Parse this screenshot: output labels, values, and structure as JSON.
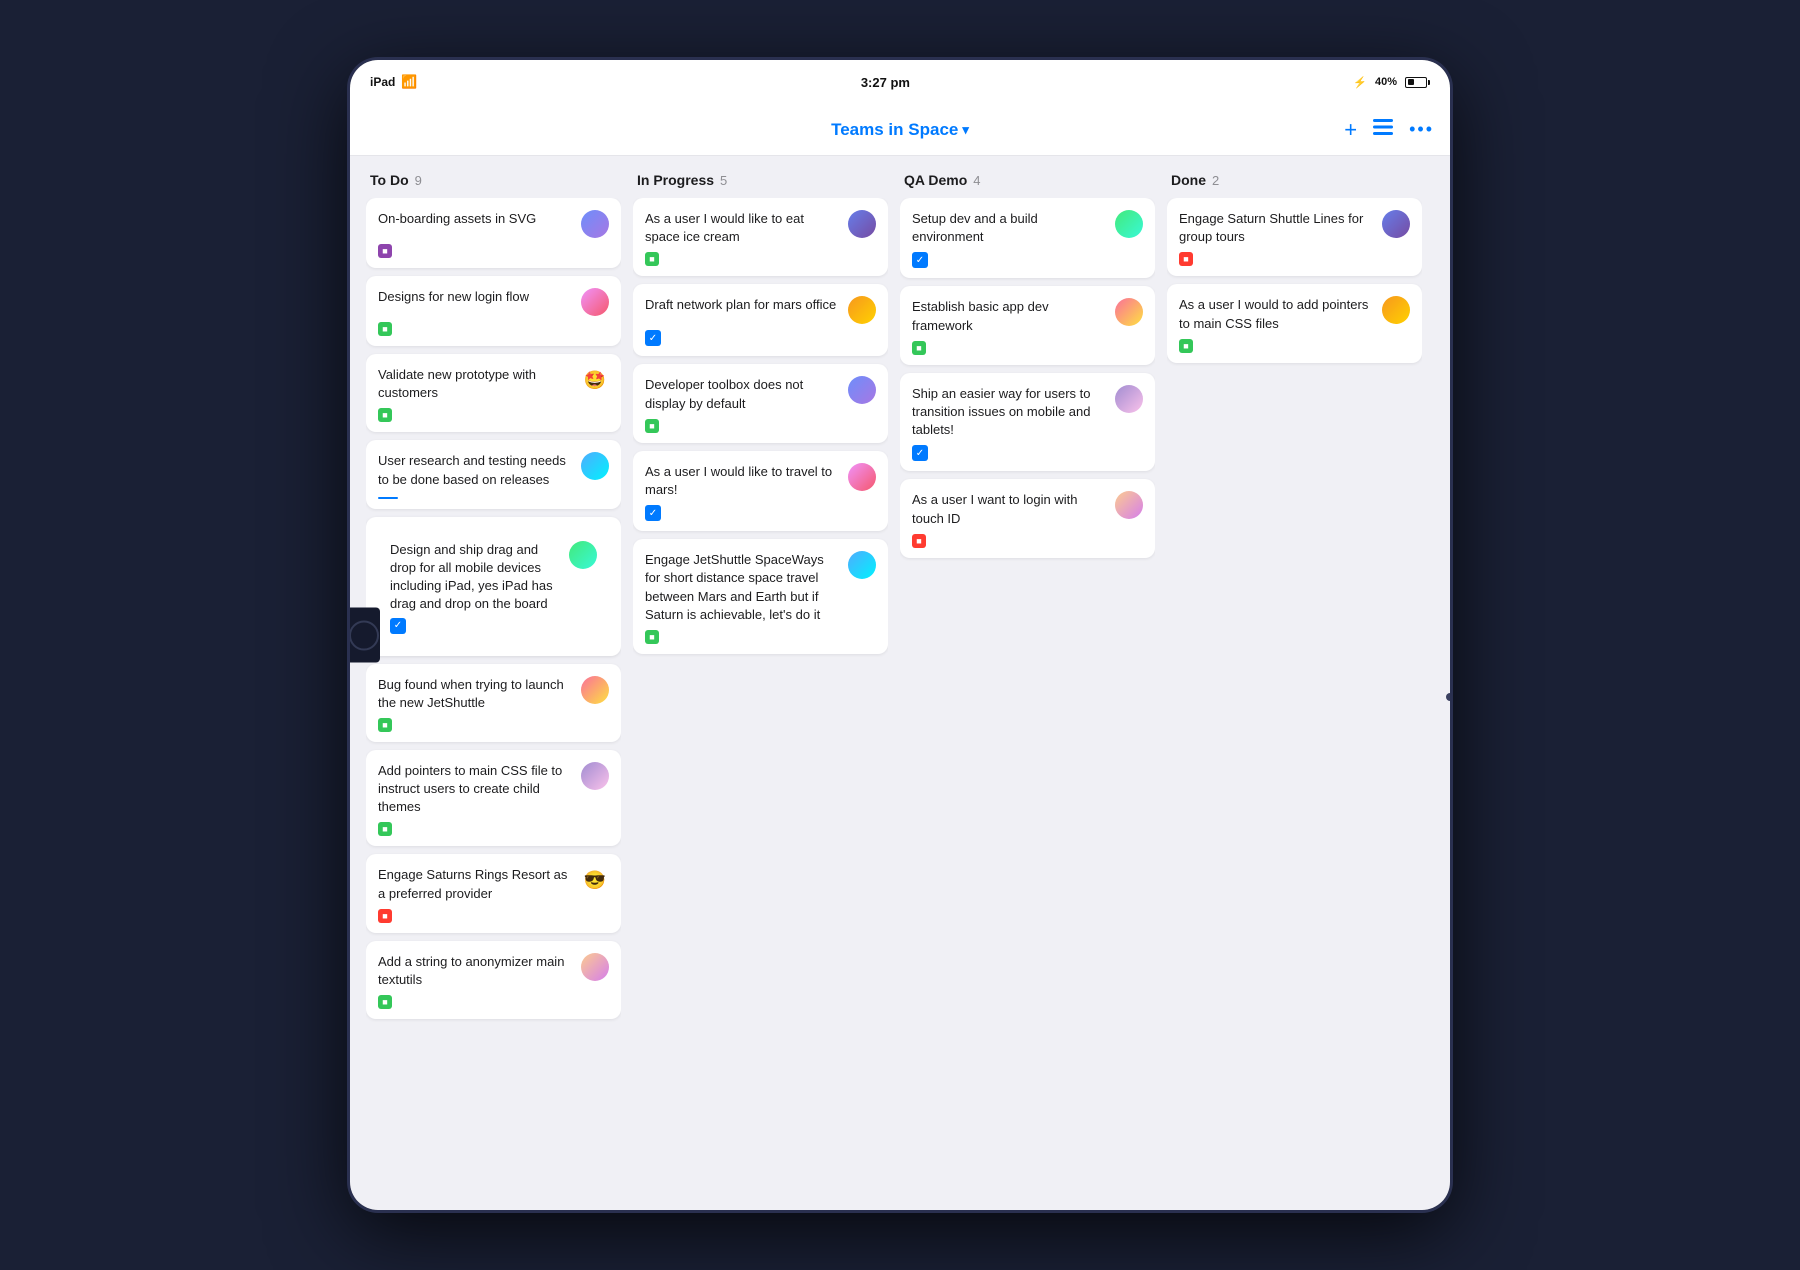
{
  "device": {
    "status_left": "iPad",
    "time": "3:27 pm",
    "battery": "40%",
    "wifi": "▾"
  },
  "header": {
    "title": "Teams in Space",
    "chevron": "▾",
    "plus_label": "+",
    "list_label": "≡",
    "more_label": "•••"
  },
  "columns": [
    {
      "id": "todo",
      "title": "To Do",
      "count": "9",
      "cards": [
        {
          "id": "c1",
          "text": "On-boarding assets in SVG",
          "avatar": "1",
          "tag": "purple"
        },
        {
          "id": "c2",
          "text": "Designs for new login flow",
          "avatar": "2",
          "tag": "green"
        },
        {
          "id": "c3",
          "text": "Validate new prototype with customers",
          "avatar": "emoji_smiley",
          "tag": "green"
        },
        {
          "id": "c4",
          "text": "User research and testing needs to be done based on releases",
          "avatar": "3",
          "tag": "blue-line"
        },
        {
          "id": "c5",
          "text": "Design and ship drag and drop for all mobile devices including iPad, yes iPad has drag and drop on the board",
          "avatar": "4",
          "tag": "blue-check",
          "expanded": true
        },
        {
          "id": "c6",
          "text": "Bug found when trying to launch the new JetShuttle",
          "avatar": "5",
          "tag": "green"
        },
        {
          "id": "c7",
          "text": "Add pointers to main CSS file to instruct users to create child themes",
          "avatar": "6",
          "tag": "green"
        },
        {
          "id": "c8",
          "text": "Engage Saturns Rings Resort as a preferred provider",
          "avatar": "emoji_smiley2",
          "tag": "red"
        },
        {
          "id": "c9",
          "text": "Add a string to anonymizer main textutils",
          "avatar": "7",
          "tag": "green"
        }
      ]
    },
    {
      "id": "inprogress",
      "title": "In Progress",
      "count": "5",
      "cards": [
        {
          "id": "p1",
          "text": "As a user I would like to eat space ice cream",
          "avatar": "8",
          "tag": "green"
        },
        {
          "id": "p2",
          "text": "Draft network plan for mars office",
          "avatar": "9",
          "tag": "blue-check"
        },
        {
          "id": "p3",
          "text": "Developer toolbox does not display by default",
          "avatar": "1",
          "tag": "green"
        },
        {
          "id": "p4",
          "text": "As a user I would like to travel to mars!",
          "avatar": "2",
          "tag": "blue-check"
        },
        {
          "id": "p5",
          "text": "Engage JetShuttle SpaceWays for short distance space travel between Mars and Earth but if Saturn is achievable, let's do it",
          "avatar": "3",
          "tag": "green"
        }
      ]
    },
    {
      "id": "qademo",
      "title": "QA Demo",
      "count": "4",
      "cards": [
        {
          "id": "q1",
          "text": "Setup dev and a build environment",
          "avatar": "4",
          "tag": "blue-check"
        },
        {
          "id": "q2",
          "text": "Establish basic app dev framework",
          "avatar": "5",
          "tag": "green"
        },
        {
          "id": "q3",
          "text": "Ship an easier way for users to transition issues on mobile and tablets!",
          "avatar": "6",
          "tag": "blue-check"
        },
        {
          "id": "q4",
          "text": "As a user I want to login with touch ID",
          "avatar": "7",
          "tag": "red"
        }
      ]
    },
    {
      "id": "done",
      "title": "Done",
      "count": "2",
      "cards": [
        {
          "id": "d1",
          "text": "Engage Saturn Shuttle Lines for group tours",
          "avatar": "8",
          "tag": "red"
        },
        {
          "id": "d2",
          "text": "As a user I would to add pointers to main CSS files",
          "avatar": "9",
          "tag": "green"
        }
      ]
    }
  ]
}
